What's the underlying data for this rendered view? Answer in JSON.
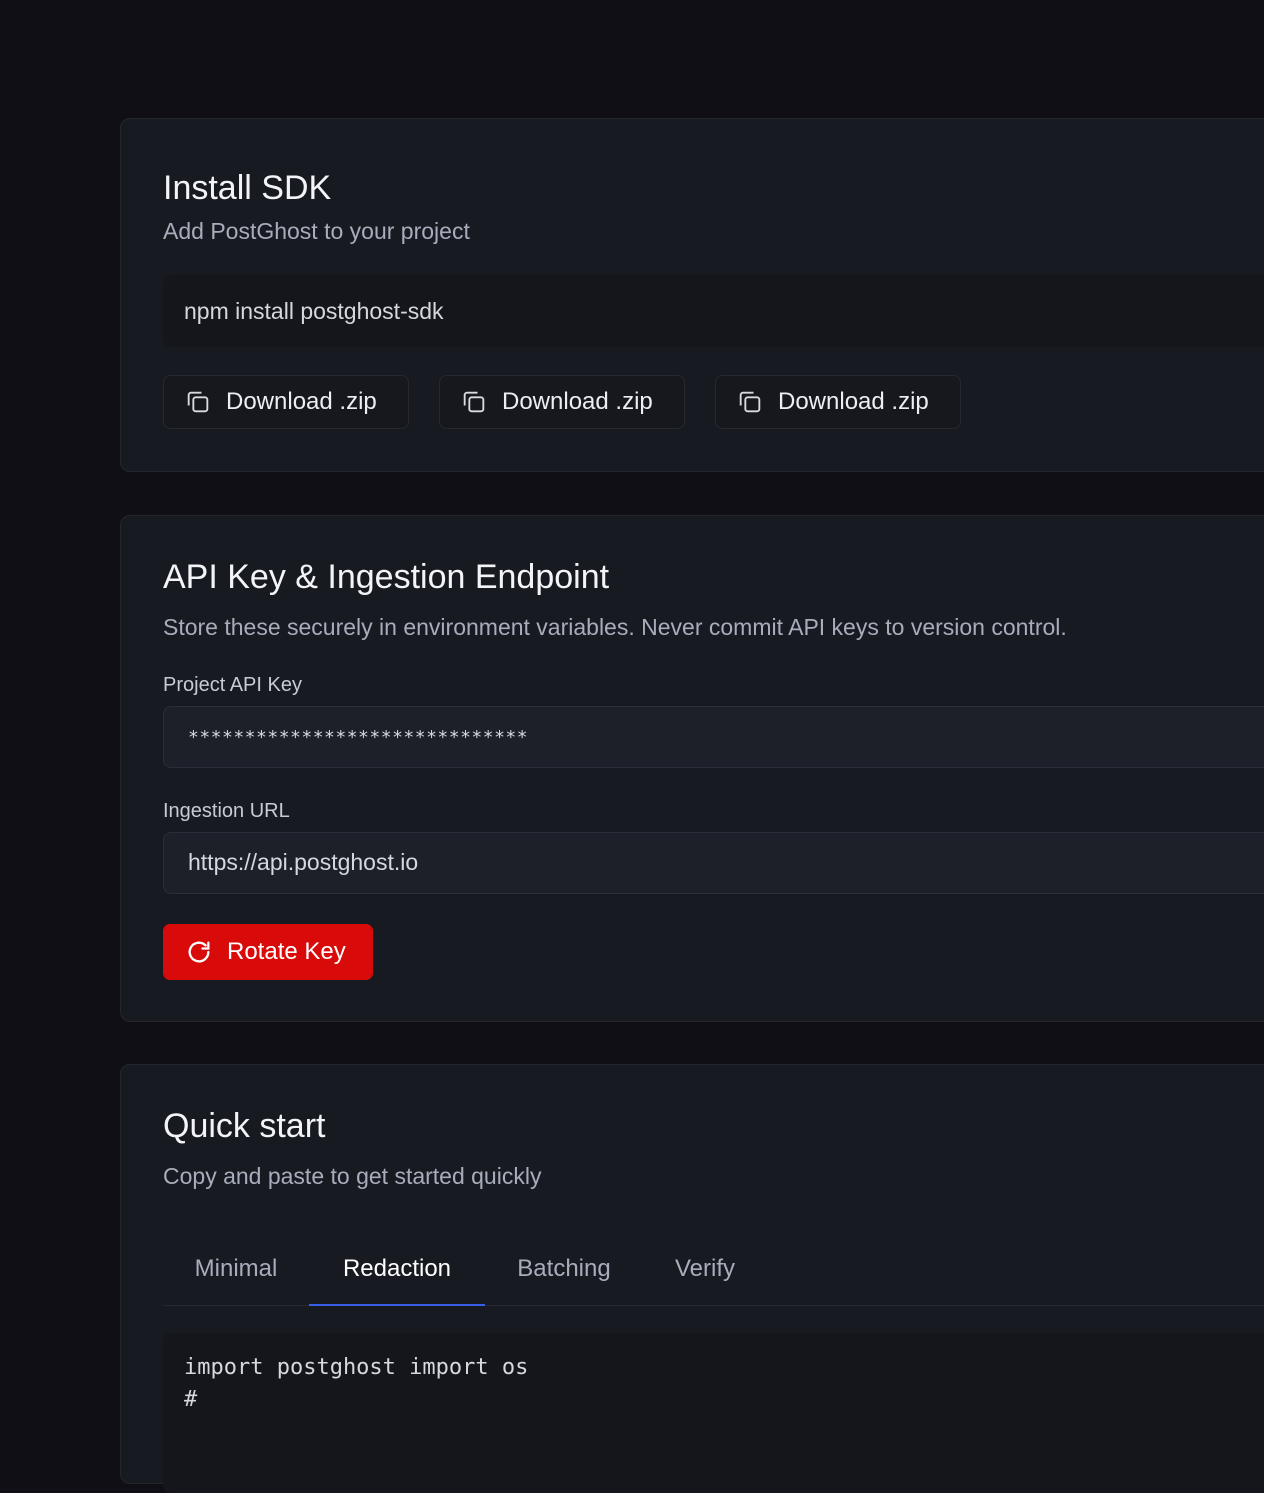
{
  "install": {
    "title": "Install SDK",
    "subtitle": "Add PostGhost to your project",
    "command": "npm install postghost-sdk",
    "buttons": [
      {
        "label": "Download .zip",
        "icon": "copy-icon"
      },
      {
        "label": "Download .zip",
        "icon": "copy-icon"
      },
      {
        "label": "Download .zip",
        "icon": "copy-icon"
      }
    ]
  },
  "api": {
    "title": "API Key & Ingestion Endpoint",
    "subtitle": "Store these securely in environment variables. Never commit API keys to version control.",
    "api_key_label": "Project API Key",
    "api_key_value": "******************************",
    "ingestion_label": "Ingestion URL",
    "ingestion_value": "https://api.postghost.io",
    "rotate_label": "Rotate Key",
    "rotate_icon": "refresh-icon",
    "accent": "#d90a0a"
  },
  "quick": {
    "title": "Quick start",
    "subtitle": "Copy and paste to get started quickly",
    "tabs": [
      {
        "label": "Minimal",
        "active": false
      },
      {
        "label": "Redaction",
        "active": true
      },
      {
        "label": "Batching",
        "active": false
      },
      {
        "label": "Verify",
        "active": false
      }
    ],
    "code_lines": [
      "import postghost import os",
      "#"
    ],
    "tab_accent": "#3b5ee8"
  }
}
